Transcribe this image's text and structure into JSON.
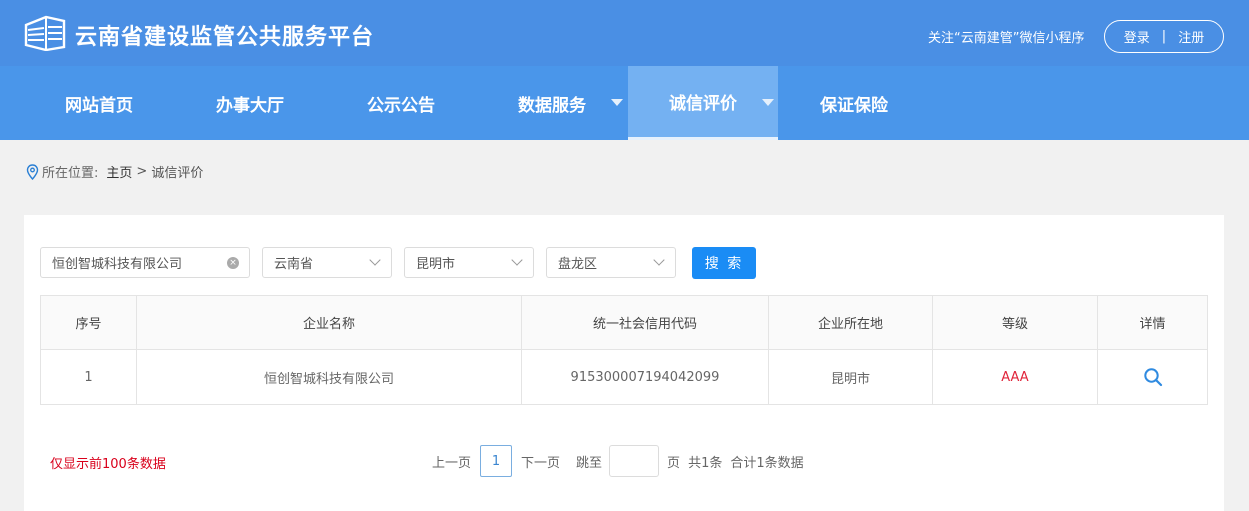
{
  "header": {
    "site_title": "云南省建设监管公共服务平台",
    "follow_text": "关注“云南建管”微信小程序",
    "login": "登录",
    "divider": "|",
    "register": "注册"
  },
  "nav": {
    "items": [
      {
        "label": "网站首页"
      },
      {
        "label": "办事大厅"
      },
      {
        "label": "公示公告"
      },
      {
        "label": "数据服务"
      },
      {
        "label": "诚信评价"
      },
      {
        "label": "保证保险"
      }
    ]
  },
  "breadcrumb": {
    "prefix": "所在位置:",
    "home": "主页",
    "separator": ">",
    "current": "诚信评价"
  },
  "filters": {
    "company_value": "恒创智城科技有限公司",
    "province": "云南省",
    "city": "昆明市",
    "district": "盘龙区",
    "search_label": "搜 索"
  },
  "table": {
    "headers": [
      "序号",
      "企业名称",
      "统一社会信用代码",
      "企业所在地",
      "等级",
      "详情"
    ],
    "rows": [
      {
        "index": "1",
        "name": "恒创智城科技有限公司",
        "code": "915300007194042099",
        "location": "昆明市",
        "level": "AAA"
      }
    ]
  },
  "footer": {
    "note": "仅显示前100条数据",
    "prev": "上一页",
    "page": "1",
    "next": "下一页",
    "jump": "跳至",
    "page_unit": "页",
    "total": "共1条",
    "total_records": "合计1条数据"
  },
  "colors": {
    "header_bg": "#4a8fe4",
    "nav_bg": "#4a96ea",
    "nav_active": "#74b1f2",
    "button": "#1a8cf5",
    "level_text": "#e0243a",
    "note_text": "#d9001b"
  }
}
